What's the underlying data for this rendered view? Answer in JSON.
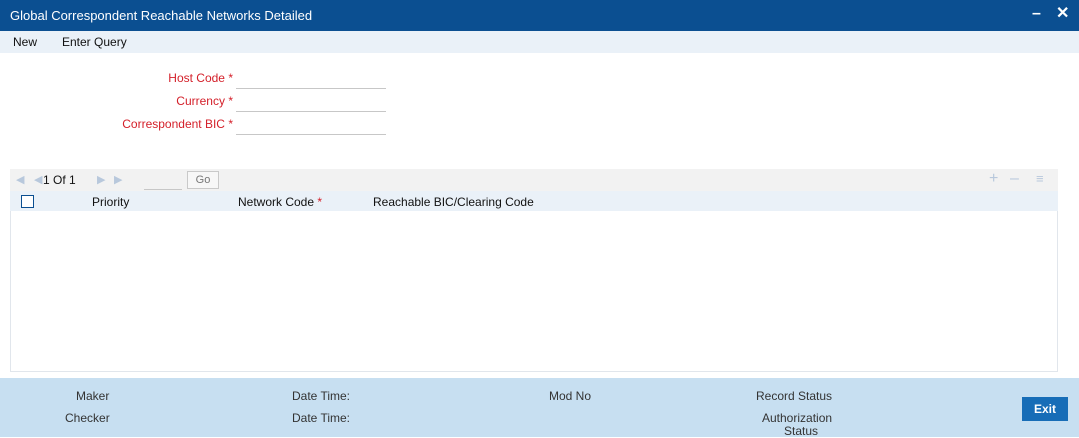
{
  "window": {
    "title": "Global Correspondent Reachable Networks Detailed",
    "minimize_glyph": "–",
    "close_glyph": "✕"
  },
  "menu": {
    "items": [
      "New",
      "Enter Query"
    ]
  },
  "form": {
    "required_mark": "*",
    "fields": [
      {
        "label": "Host Code",
        "value": ""
      },
      {
        "label": "Currency",
        "value": ""
      },
      {
        "label": "Correspondent BIC",
        "value": ""
      }
    ]
  },
  "grid": {
    "pagination": {
      "first_icon": "first-page-icon",
      "prev_icon": "prev-page-icon",
      "next_icon": "next-page-icon",
      "last_icon": "last-page-icon",
      "page_text": "1 Of 1",
      "page_input": "",
      "go_label": "Go"
    },
    "actions": [
      "add-row-icon",
      "delete-row-icon",
      "single-view-icon"
    ],
    "columns": [
      "Priority",
      "Network Code",
      "Reachable BIC/Clearing Code"
    ],
    "required_mark": "*",
    "rows": []
  },
  "footer": {
    "maker": "Maker",
    "checker": "Checker",
    "date_time_1": "Date Time:",
    "date_time_2": "Date Time:",
    "mod_no": "Mod No",
    "record_status": "Record Status",
    "authorization_status_1": "Authorization",
    "authorization_status_2": "Status",
    "exit_label": "Exit"
  }
}
